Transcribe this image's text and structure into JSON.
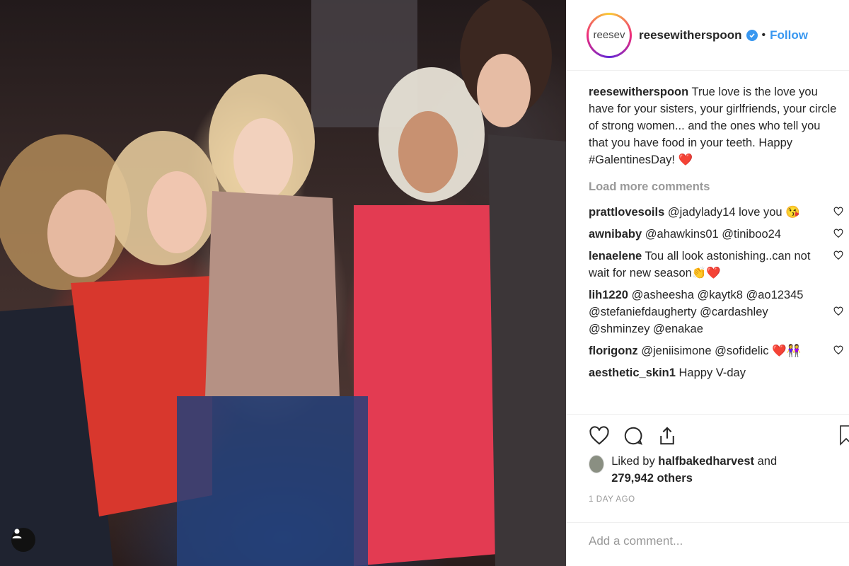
{
  "post": {
    "username": "reesewitherspoon",
    "avatar_alt": "reesev",
    "follow_label": "Follow",
    "dot": "•",
    "caption_text": "True love is the love you have for your sisters, your girlfriends, your circle of strong women... and the ones who tell you that you have food in your teeth. Happy #GalentinesDay! ❤️",
    "load_more": "Load more comments",
    "comments": [
      {
        "user": "prattlovesoils",
        "text": "@jadylady14 love you 😘"
      },
      {
        "user": "awnibaby",
        "text": "@ahawkins01 @tiniboo24"
      },
      {
        "user": "lenaelene",
        "text": "Tou all look astonishing..can not wait for new season👏❤️"
      },
      {
        "user": "lih1220",
        "text": "@asheesha @kaytk8 @ao12345 @stefaniefdaugherty @cardashley @shminzey @enakae"
      },
      {
        "user": "florigonz",
        "text": "@jeniisimone @sofidelic ❤️👭"
      },
      {
        "user": "aesthetic_skin1",
        "text": "Happy V-day"
      }
    ],
    "likes": {
      "prefix": "Liked by",
      "user": "halfbakedharvest",
      "suffix": "and",
      "count": "279,942 others"
    },
    "timestamp": "1 DAY AGO",
    "add_comment_placeholder": "Add a comment..."
  },
  "icons": {
    "like": "heart-icon",
    "comment": "comment-icon",
    "share": "share-icon",
    "save": "bookmark-icon",
    "verified": "verified-badge-icon",
    "profile": "user-icon"
  },
  "colors": {
    "accent": "#3897f0",
    "text": "#262626",
    "muted": "#999999",
    "border": "#efefef"
  }
}
